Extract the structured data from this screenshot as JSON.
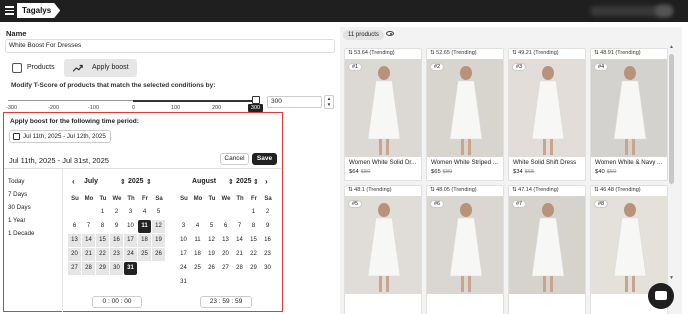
{
  "app": {
    "logo_text": "Tagalys"
  },
  "form": {
    "name_label": "Name",
    "name_value": "White Boost For Dresses",
    "tabs": [
      {
        "label": "Products",
        "icon": "product-scan-icon",
        "active": false
      },
      {
        "label": "Apply boost",
        "icon": "trending-up-icon",
        "active": true
      }
    ],
    "modify_text": "Modify T-Score of products that match the selected conditions by:",
    "slider": {
      "ticks": [
        "-300",
        "-200",
        "-100",
        "0",
        "100",
        "200"
      ],
      "value_tooltip": "300",
      "value": 300,
      "min": -300,
      "max": 300
    },
    "score_input": "300"
  },
  "boost": {
    "title": "Apply boost for the following time period:",
    "date_chip": "Jul 11th, 2025 - Jul 12th, 2025",
    "picker": {
      "range_text": "Jul 11th, 2025 - Jul 31st, 2025",
      "cancel_label": "Cancel",
      "save_label": "Save",
      "presets": [
        "Today",
        "7 Days",
        "30 Days",
        "1 Year",
        "1 Decade"
      ],
      "weekdays": [
        "Su",
        "Mo",
        "Tu",
        "We",
        "Th",
        "Fr",
        "Sa"
      ],
      "left_month": {
        "month": "July",
        "year": "2025"
      },
      "right_month": {
        "month": "August",
        "year": "2025"
      },
      "start_time": {
        "h": "0",
        "m": "00",
        "s": "00"
      },
      "end_time": {
        "h": "23",
        "m": "59",
        "s": "59"
      }
    }
  },
  "products": {
    "count_label": "11 products",
    "items": [
      {
        "score": "53.64 (Trending)",
        "rank": "#1",
        "title": "Women White Solid Dr...",
        "price": "$64",
        "old_price": "$80"
      },
      {
        "score": "52.65 (Trending)",
        "rank": "#2",
        "title": "Women White Striped ...",
        "price": "$65",
        "old_price": "$80"
      },
      {
        "score": "49.21 (Trending)",
        "rank": "#3",
        "title": "White Solid Shift Dress",
        "price": "$34",
        "old_price": "$65"
      },
      {
        "score": "48.91 (Trending)",
        "rank": "#4",
        "title": "Women White & Navy ...",
        "price": "$40",
        "old_price": "$50"
      },
      {
        "score": "48.1 (Trending)",
        "rank": "#5",
        "title": "",
        "price": "",
        "old_price": ""
      },
      {
        "score": "48.05 (Trending)",
        "rank": "#6",
        "title": "",
        "price": "",
        "old_price": ""
      },
      {
        "score": "47.14 (Trending)",
        "rank": "#7",
        "title": "",
        "price": "",
        "old_price": ""
      },
      {
        "score": "46.48 (Trending)",
        "rank": "#8",
        "title": "",
        "price": "",
        "old_price": ""
      }
    ]
  },
  "colors": {
    "accent": "#222222",
    "highlight_border": "#e03a3a",
    "range_fill": "#e6e6e6"
  }
}
